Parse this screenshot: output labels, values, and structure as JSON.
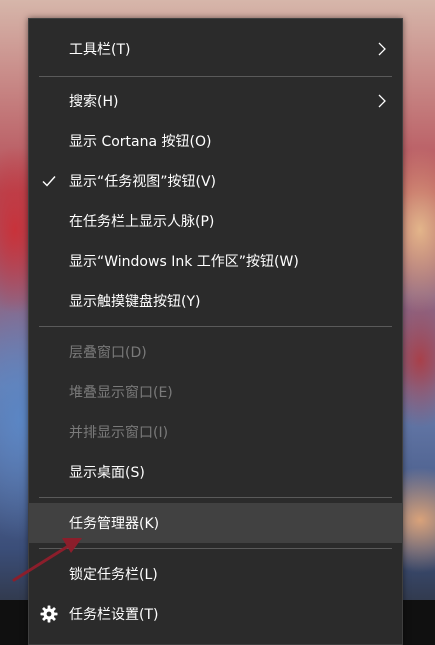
{
  "menu": {
    "items": [
      {
        "label": "工具栏(T)"
      },
      {
        "label": "搜索(H)"
      },
      {
        "label": "显示 Cortana 按钮(O)"
      },
      {
        "label": "显示“任务视图”按钮(V)"
      },
      {
        "label": "在任务栏上显示人脉(P)"
      },
      {
        "label": "显示“Windows Ink 工作区”按钮(W)"
      },
      {
        "label": "显示触摸键盘按钮(Y)"
      },
      {
        "label": "层叠窗口(D)"
      },
      {
        "label": "堆叠显示窗口(E)"
      },
      {
        "label": "并排显示窗口(I)"
      },
      {
        "label": "显示桌面(S)"
      },
      {
        "label": "任务管理器(K)"
      },
      {
        "label": "锁定任务栏(L)"
      },
      {
        "label": "任务栏设置(T)"
      }
    ]
  },
  "colors": {
    "menu_bg": "#2b2b2b",
    "hover_bg": "#414141",
    "disabled_text": "#7a7a7a",
    "annotation_arrow": "#8b1e2b"
  },
  "icons": [
    "chevron-right-icon",
    "checkmark-icon",
    "gear-icon",
    "annotation-arrow"
  ]
}
